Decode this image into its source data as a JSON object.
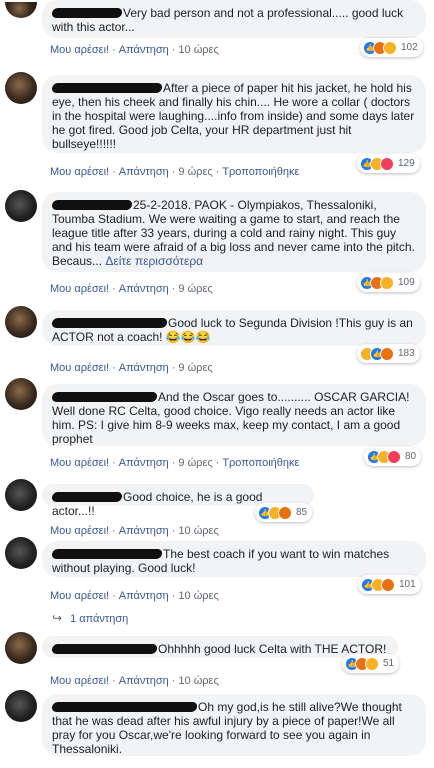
{
  "comments": [
    {
      "text": "Very bad person and not a professional..... good luck with this actor...",
      "like": "Μου αρέσει!",
      "reply": "Απάντηση",
      "time": "10 ώρες",
      "edited": "",
      "reactions": [
        "like",
        "angry",
        "haha"
      ],
      "count": "102"
    },
    {
      "text": "After a piece of paper hit his jacket, he hold his eye, then his cheek and finally his chin.... He wore a collar ( doctors in the hospital were laughing....info from inside) and some days later he got fired. Good job Celta, your HR department just hit bullseye!!!!!!",
      "like": "Μου αρέσει!",
      "reply": "Απάντηση",
      "time": "9 ώρες",
      "edited": "Τροποποιήθηκε",
      "reactions": [
        "like",
        "haha",
        "love"
      ],
      "count": "129"
    },
    {
      "text": "25-2-2018. PAOK - Olympiakos, Thessaloniki, Toumba Stadium. We were waiting a game to start, and reach the league title after 33 years, during a cold and rainy night. This guy and his team were afraid of a big loss and never came into the pitch. Becaus...",
      "see_more": "Δείτε περισσότερα",
      "like": "Μου αρέσει!",
      "reply": "Απάντηση",
      "time": "9 ώρες",
      "edited": "",
      "reactions": [
        "like",
        "angry",
        "haha"
      ],
      "count": "109"
    },
    {
      "text": "Good luck to Segunda Division !This guy is an ACTOR not a coach! 😂😂😂",
      "like": "Μου αρέσει!",
      "reply": "Απάντηση",
      "time": "9 ώρες",
      "edited": "",
      "reactions": [
        "haha",
        "like",
        "angry"
      ],
      "count": "183"
    },
    {
      "text": "And the Oscar goes to.......... OSCAR GARCIA! Well done RC Celta, good choice. Vigo really needs an actor like him. PS: I give him 8-9 weeks max, keep my contact, I am a good prophet",
      "like": "Μου αρέσει!",
      "reply": "Απάντηση",
      "time": "9 ώρες",
      "edited": "Τροποποιήθηκε",
      "reactions": [
        "like",
        "haha",
        "love"
      ],
      "count": "80"
    },
    {
      "text": "Good choice, he is a good actor...!!",
      "like": "Μου αρέσει!",
      "reply": "Απάντηση",
      "time": "10 ώρες",
      "edited": "",
      "reactions": [
        "like",
        "haha",
        "angry"
      ],
      "count": "85"
    },
    {
      "text": "The best coach if you want to win matches without playing. Good luck!",
      "like": "Μου αρέσει!",
      "reply": "Απάντηση",
      "time": "10 ώρες",
      "edited": "",
      "reactions": [
        "like",
        "haha",
        "angry"
      ],
      "count": "101",
      "replies": "1 απάντηση"
    },
    {
      "text": "Ohhhhh good luck Celta with THE ACTOR!",
      "like": "Μου αρέσει!",
      "reply": "Απάντηση",
      "time": "10 ώρες",
      "edited": "",
      "reactions": [
        "like",
        "angry",
        "haha"
      ],
      "count": "51"
    },
    {
      "text": "Oh my god,is he still alive?We thought that he was dead after his awful injury by a piece of paper!We all pray for you Oscar,we're looking forward to see you again in Thessaloniki."
    }
  ]
}
